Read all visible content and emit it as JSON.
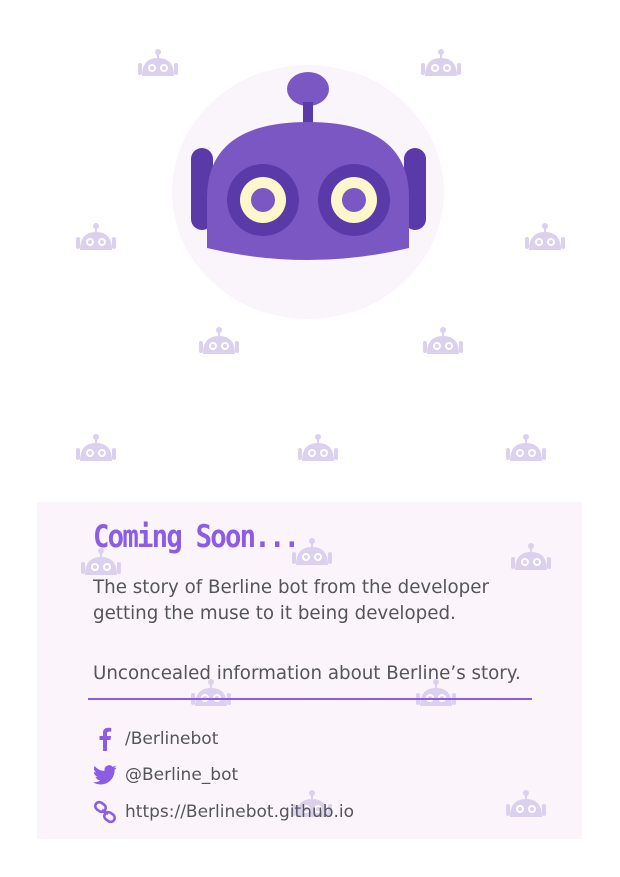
{
  "brand": {
    "accent": "#8c5ce4",
    "bot_body": "#7a57c2",
    "bot_dark": "#5a3aa8",
    "eye": "#fff7cc",
    "watermark": "#dcd0ef"
  },
  "card": {
    "title": "Coming Soon...",
    "description": "The story of Berline bot from the developer getting the muse to it being developed.",
    "info": "Unconcealed information about Berline’s story."
  },
  "social": [
    {
      "icon": "facebook-icon",
      "text": "/Berlinebot"
    },
    {
      "icon": "twitter-icon",
      "text": "@Berline_bot"
    },
    {
      "icon": "link-icon",
      "text": "https://Berlinebot.github.io"
    }
  ]
}
